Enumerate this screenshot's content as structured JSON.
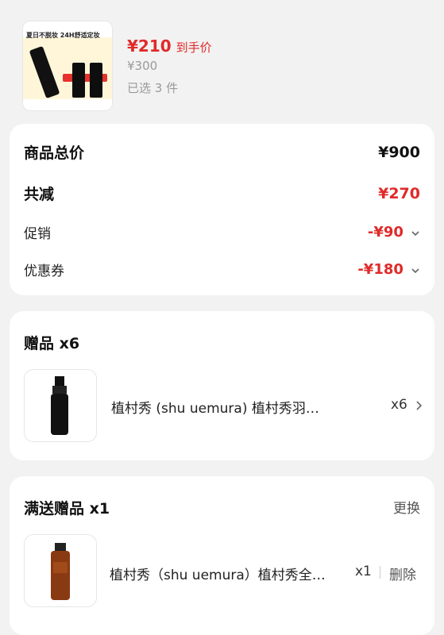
{
  "product": {
    "thumb_banner": "夏日不脱妆 24H舒适定妆",
    "price": "¥210",
    "price_suffix": "到手价",
    "original_price": "¥300",
    "selected": "已选 3 件"
  },
  "summary": {
    "total_label": "商品总价",
    "total_value": "¥900",
    "discount_label": "共减",
    "discount_value": "¥270",
    "promo_label": "促销",
    "promo_value": "-¥90",
    "coupon_label": "优惠券",
    "coupon_value": "-¥180"
  },
  "gift": {
    "title": "赠品 x6",
    "name": "植村秀 (shu uemura) 植村秀羽…",
    "qty": "x6"
  },
  "full_gift": {
    "title": "满送赠品 x1",
    "action": "更换",
    "name": "植村秀（shu uemura）植村秀全…",
    "qty": "x1",
    "delete": "删除"
  },
  "colors": {
    "accent": "#e02a2a",
    "background": "#f2f2f2"
  }
}
